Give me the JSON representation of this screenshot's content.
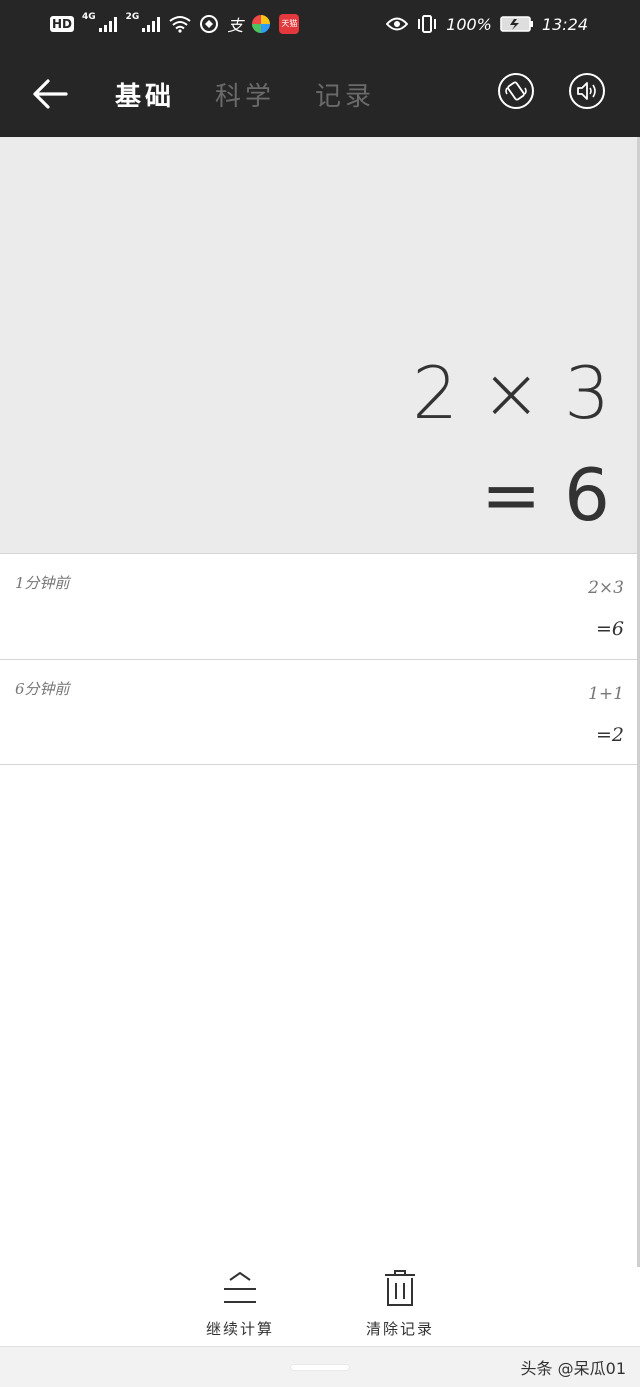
{
  "status_bar": {
    "hd": "HD",
    "net1": "4G",
    "net2": "2G",
    "alipay": "支",
    "tmall": "天猫",
    "battery_pct": "100%",
    "time": "13:24"
  },
  "header": {
    "tabs": [
      {
        "label": "基础",
        "active": true
      },
      {
        "label": "科学",
        "active": false
      },
      {
        "label": "记录",
        "active": false
      }
    ]
  },
  "display": {
    "expression": "2 × 3",
    "result": "= 6"
  },
  "history": [
    {
      "time": "1分钟前",
      "expression": "2×3",
      "result": "=6"
    },
    {
      "time": "6分钟前",
      "expression": "1+1",
      "result": "=2"
    }
  ],
  "actions": {
    "continue_label": "继续计算",
    "clear_label": "清除记录"
  },
  "watermark": "头条 @呆瓜01",
  "colors": {
    "header_bg": "#262626",
    "display_bg": "#ebebeb",
    "text_dark": "#333333",
    "tab_inactive": "#6a6a6a"
  }
}
